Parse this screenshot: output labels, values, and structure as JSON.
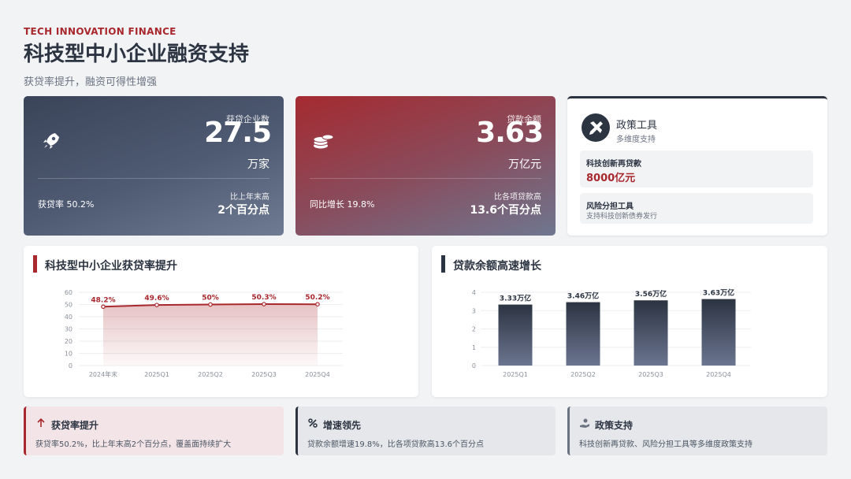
{
  "header": {
    "eyebrow": "TECH INNOVATION FINANCE",
    "title": "科技型中小企业融资支持",
    "subtitle": "获贷率提升，融资可得性增强"
  },
  "kpi_enterprises": {
    "icon": "rocket-icon",
    "label": "获贷企业数",
    "value": "27.5",
    "unit": "万家",
    "rate": "获贷率 50.2%",
    "compare_label": "比上年末高",
    "compare_value": "2个百分点"
  },
  "kpi_loans": {
    "icon": "coins-icon",
    "label": "贷款余额",
    "value": "3.63",
    "unit": "万亿元",
    "rate": "同比增长 19.8%",
    "compare_label": "比各项贷款高",
    "compare_value": "13.6个百分点"
  },
  "policy": {
    "icon": "tools-icon",
    "title": "政策工具",
    "subtitle": "多维度支持",
    "item1_title": "科技创新再贷款",
    "item1_value": "8000亿元",
    "item2_title": "风险分担工具",
    "item2_desc": "支持科技创新债券发行"
  },
  "panel_rate": {
    "title": "科技型中小企业获贷率提升"
  },
  "panel_loans": {
    "title": "贷款余额高速增长"
  },
  "chart_data": [
    {
      "type": "area",
      "categories": [
        "2024年末",
        "2025Q1",
        "2025Q2",
        "2025Q3",
        "2025Q4"
      ],
      "values": [
        48.2,
        49.6,
        50,
        50.3,
        50.2
      ],
      "data_labels": [
        "48.2%",
        "49.6%",
        "50%",
        "50.3%",
        "50.2%"
      ],
      "ylim": [
        0,
        60
      ],
      "yticks": [
        0,
        10,
        20,
        30,
        40,
        50,
        60
      ],
      "color": "#a8282e",
      "grid": true
    },
    {
      "type": "bar",
      "categories": [
        "2025Q1",
        "2025Q2",
        "2025Q3",
        "2025Q4"
      ],
      "values": [
        3.33,
        3.46,
        3.56,
        3.63
      ],
      "data_labels": [
        "3.33万亿",
        "3.46万亿",
        "3.56万亿",
        "3.63万亿"
      ],
      "ylim": [
        0,
        4
      ],
      "yticks": [
        0,
        1,
        2,
        3,
        4
      ],
      "color": "#2c3442",
      "grid": true
    }
  ],
  "notes": [
    {
      "icon": "arrow-up-icon",
      "title": "获贷率提升",
      "desc": "获贷率50.2%，比上年末高2个百分点，覆盖面持续扩大"
    },
    {
      "icon": "percent-icon",
      "title": "增速领先",
      "desc": "贷款余额增速19.8%，比各项贷款高13.6个百分点"
    },
    {
      "icon": "hand-coin-icon",
      "title": "政策支持",
      "desc": "科技创新再贷款、风险分担工具等多维度政策支持"
    }
  ]
}
